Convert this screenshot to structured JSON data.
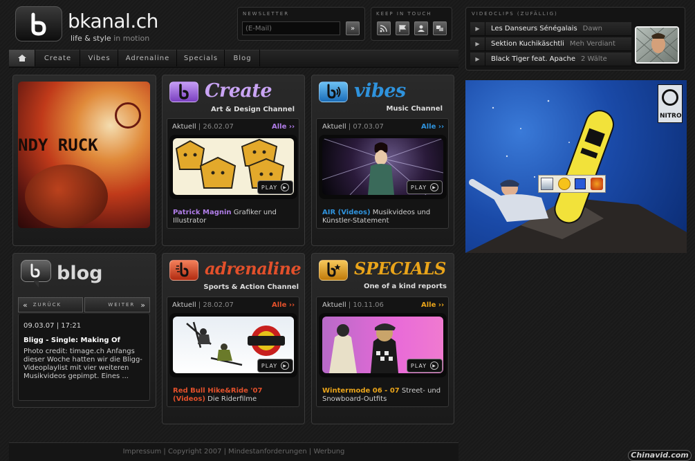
{
  "header": {
    "logo_text": "bkanal.ch",
    "tagline_a": "life & style",
    "tagline_b": "in motion",
    "newsletter_title": "NEWSLETTER",
    "newsletter_placeholder": "(E-Mail)",
    "keep_title": "KEEP IN TOUCH",
    "submit_icon": "double-chevron-right-icon",
    "keep_icons": [
      "rss-icon",
      "flag-icon",
      "contact-card-icon",
      "community-icon"
    ]
  },
  "nav": {
    "home_icon": "home-icon",
    "items": [
      "Create",
      "Vibes",
      "Adrenaline",
      "Specials",
      "Blog"
    ]
  },
  "channels": {
    "create": {
      "title": "Create",
      "subtitle": "Art & Design Channel",
      "color": "#b07de8",
      "aktuell": "Aktuell",
      "date": "26.02.07",
      "alle": "Alle ››",
      "play": "PLAY",
      "desc_highlight": "Patrick Magnin",
      "desc_text": " Grafiker und Illustrator"
    },
    "vibes": {
      "title": "vibes",
      "subtitle": "Music Channel",
      "color": "#2f93dd",
      "aktuell": "Aktuell",
      "date": "07.03.07",
      "alle": "Alle ››",
      "play": "PLAY",
      "desc_highlight": "AIR (Videos)",
      "desc_text": " Musikvideos und Künstler-Statement"
    },
    "adrenaline": {
      "title": "adrenaline",
      "subtitle": "Sports & Action Channel",
      "color": "#e2502b",
      "aktuell": "Aktuell",
      "date": "28.02.07",
      "alle": "Alle ››",
      "play": "PLAY",
      "desc_highlight": "Red Bull Hike&Ride '07 (Videos)",
      "desc_text": " Die Riderfilme"
    },
    "specials": {
      "title": "SPECIALS",
      "subtitle": "One of a kind reports",
      "color": "#e9a41a",
      "aktuell": "Aktuell",
      "date": "10.11.06",
      "alle": "Alle ››",
      "play": "PLAY",
      "desc_highlight": "Wintermode 06 - 07",
      "desc_text": " Street- und Snowboard-Outfits"
    }
  },
  "feature_text": "NDY RUCK",
  "blog": {
    "title": "blog",
    "back": "ZURÜCK",
    "next": "WEITER",
    "timestamp": "09.03.07 | 17:21",
    "post_title": "Bligg - Single: Making Of",
    "post_body": "Photo credit: timage.ch Anfangs dieser Woche hatten wir die Bligg-Videoplaylist mit vier weiteren Musikvideos gepimpt. Eines ..."
  },
  "videoclips": {
    "title": "VIDEOCLIPS (ZUFÄLLIG)",
    "items": [
      {
        "title": "Les Danseurs Sénégalais",
        "artist": "Dawn"
      },
      {
        "title": "Sektion Kuchikäschtli",
        "artist": "Meh Verdiant"
      },
      {
        "title": "Black Tiger feat. Apache",
        "artist": "2 Wälte"
      }
    ]
  },
  "ad": {
    "brand": "NITRO",
    "toolbar_icons": [
      "media-icon",
      "smiley-icon",
      "save-icon",
      "messenger-icon"
    ]
  },
  "footer": {
    "links": [
      "Impressum",
      "Copyright 2007",
      "Mindestanforderungen",
      "Werbung"
    ],
    "separator": " | "
  },
  "watermark": "Chinavid.com"
}
